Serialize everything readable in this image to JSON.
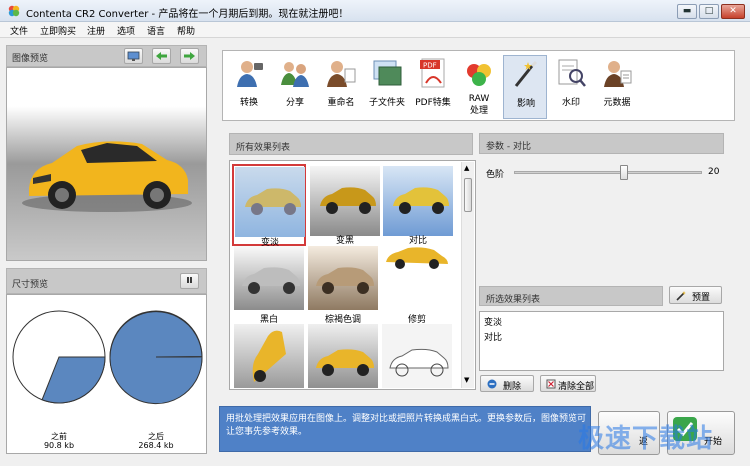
{
  "window": {
    "title": "Contenta CR2 Converter  - 产品将在一个月期后到期。现在就注册吧！",
    "minimize_symbol": "▬",
    "maximize_symbol": "□",
    "close_symbol": "✕"
  },
  "menu": [
    "文件",
    "立即购买",
    "注册",
    "选项",
    "语言",
    "帮助"
  ],
  "left": {
    "preview_title": "图像预览",
    "size_title": "尺寸预览",
    "pause_symbol": "II",
    "before_label": "之前",
    "before_size": "90.8 kb",
    "after_label": "之后",
    "after_size": "268.4 kb",
    "before_fraction": 0.65,
    "after_fraction": 0.25
  },
  "toolbar": {
    "tools": [
      {
        "label": "转换",
        "icon": "convert-icon"
      },
      {
        "label": "分享",
        "icon": "share-icon"
      },
      {
        "label": "重命名",
        "icon": "rename-icon"
      },
      {
        "label": "子文件夹",
        "icon": "subfolder-icon"
      },
      {
        "label": "PDF特集",
        "icon": "pdf-icon"
      },
      {
        "label": "RAW\n处理",
        "icon": "raw-icon"
      },
      {
        "label": "影响",
        "icon": "effects-icon"
      },
      {
        "label": "水印",
        "icon": "watermark-icon"
      },
      {
        "label": "元数据",
        "icon": "metadata-icon"
      }
    ]
  },
  "effects": {
    "title": "所有效果列表",
    "items": [
      "变淡",
      "变黑",
      "对比",
      "黑白",
      "棕褐色调",
      "修剪"
    ]
  },
  "params": {
    "title": "参数 - 对比",
    "color_label": "色阶",
    "color_value": "20"
  },
  "selected": {
    "title": "所选效果列表",
    "preset_label": "预置",
    "items": [
      "变淡",
      "对比"
    ],
    "delete_label": "删除",
    "clear_label": "清除全部"
  },
  "tip": {
    "text": "用批处理把效果应用在图像上。调整对比或把照片转换成黑白式。更换参数后，图像预览可让您事先参考效果。"
  },
  "bottom": {
    "back_label": "返",
    "start_label": "开始"
  },
  "watermark": "极速下载站",
  "colors": {
    "accent": "#4f81c7",
    "pie": "#5b87bf",
    "selection": "#d33a3a",
    "car": "#f2b51d"
  }
}
